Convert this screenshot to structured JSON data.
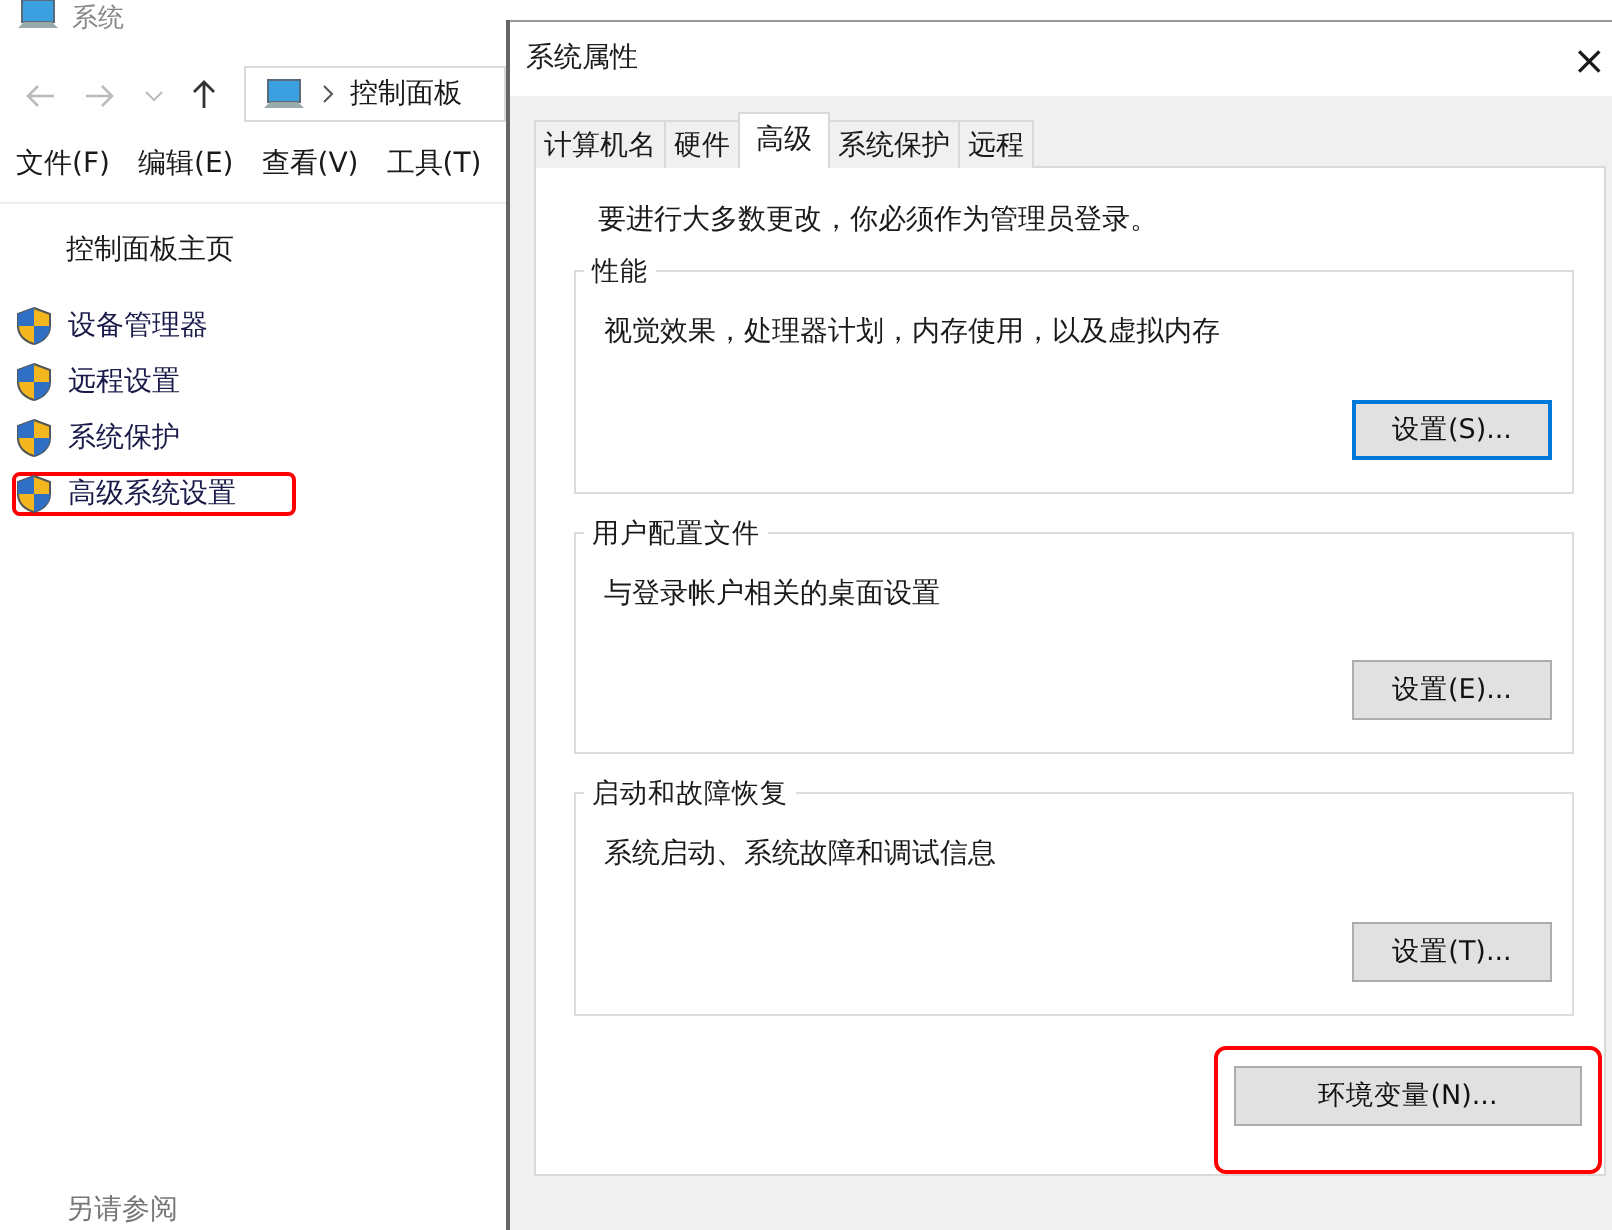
{
  "explorer": {
    "title": "系统",
    "breadcrumb": [
      "控制面板"
    ],
    "menu": [
      "文件(F)",
      "编辑(E)",
      "查看(V)",
      "工具(T)"
    ],
    "home_link": "控制面板主页",
    "links": [
      {
        "label": "设备管理器",
        "highlighted": false
      },
      {
        "label": "远程设置",
        "highlighted": false
      },
      {
        "label": "系统保护",
        "highlighted": false
      },
      {
        "label": "高级系统设置",
        "highlighted": true
      }
    ],
    "see_also": "另请参阅"
  },
  "dialog": {
    "title": "系统属性",
    "close": "×",
    "tabs": [
      {
        "label": "计算机名",
        "selected": false
      },
      {
        "label": "硬件",
        "selected": false
      },
      {
        "label": "高级",
        "selected": true
      },
      {
        "label": "系统保护",
        "selected": false
      },
      {
        "label": "远程",
        "selected": false
      }
    ],
    "notice": "要进行大多数更改，你必须作为管理员登录。",
    "groups": [
      {
        "title": "性能",
        "description": "视觉效果，处理器计划，内存使用，以及虚拟内存",
        "button": {
          "label": "设置(S)...",
          "focused": true
        }
      },
      {
        "title": "用户配置文件",
        "description": "与登录帐户相关的桌面设置",
        "button": {
          "label": "设置(E)...",
          "focused": false
        }
      },
      {
        "title": "启动和故障恢复",
        "description": "系统启动、系统故障和调试信息",
        "button": {
          "label": "设置(T)...",
          "focused": false
        }
      }
    ],
    "env_button": {
      "label": "环境变量(N)...",
      "highlighted": true
    }
  }
}
